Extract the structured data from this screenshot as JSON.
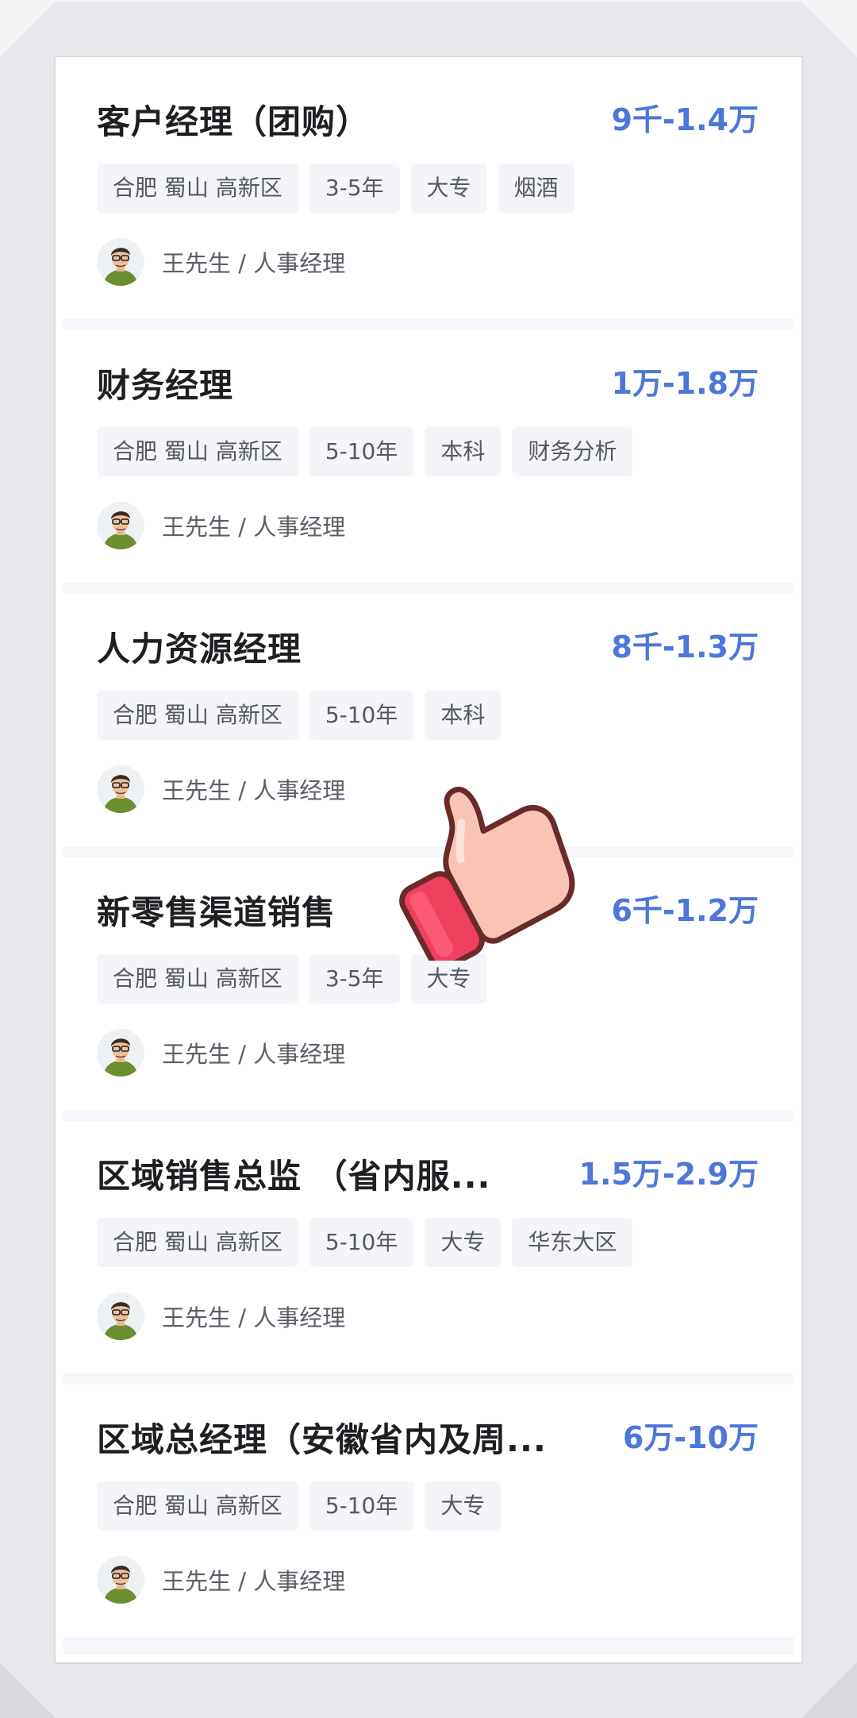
{
  "jobs": [
    {
      "title": "客户经理（团购）",
      "salary": "9千-1.4万",
      "tags": [
        "合肥 蜀山 高新区",
        "3-5年",
        "大专",
        "烟酒"
      ],
      "poster": "王先生 / 人事经理"
    },
    {
      "title": "财务经理",
      "salary": "1万-1.8万",
      "tags": [
        "合肥 蜀山 高新区",
        "5-10年",
        "本科",
        "财务分析"
      ],
      "poster": "王先生 / 人事经理"
    },
    {
      "title": "人力资源经理",
      "salary": "8千-1.3万",
      "tags": [
        "合肥 蜀山 高新区",
        "5-10年",
        "本科"
      ],
      "poster": "王先生 / 人事经理"
    },
    {
      "title": "新零售渠道销售",
      "salary": "6千-1.2万",
      "tags": [
        "合肥 蜀山 高新区",
        "3-5年",
        "大专"
      ],
      "poster": "王先生 / 人事经理"
    },
    {
      "title": "区域销售总监 （省内服...",
      "salary": "1.5万-2.9万",
      "tags": [
        "合肥 蜀山 高新区",
        "5-10年",
        "大专",
        "华东大区"
      ],
      "poster": "王先生 / 人事经理"
    },
    {
      "title": "区域总经理（安徽省内及周...",
      "salary": "6万-10万",
      "tags": [
        "合肥 蜀山 高新区",
        "5-10年",
        "大专"
      ],
      "poster": "王先生 / 人事经理"
    }
  ],
  "overlay": {
    "icon": "thumbs-up-icon"
  },
  "colors": {
    "salary": "#4d77d9",
    "title": "#1f1f23",
    "tag_bg": "#f4f5f8",
    "list_bg": "#f5f6f9"
  }
}
